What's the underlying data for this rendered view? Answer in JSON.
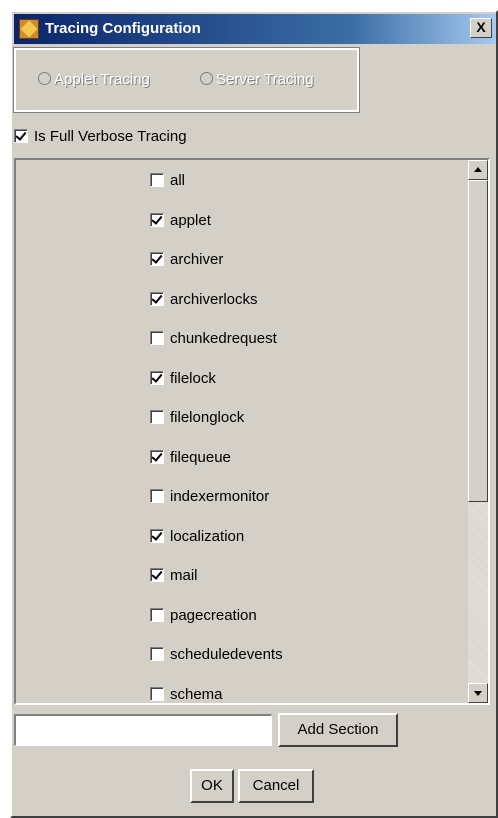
{
  "window": {
    "title": "Tracing Configuration",
    "close_label": "X"
  },
  "tracing_mode": {
    "options": [
      "Applet Tracing",
      "Server Tracing"
    ]
  },
  "verbose": {
    "label": "Is Full Verbose Tracing",
    "checked": true
  },
  "sections": [
    {
      "label": "all",
      "checked": false
    },
    {
      "label": "applet",
      "checked": true
    },
    {
      "label": "archiver",
      "checked": true
    },
    {
      "label": "archiverlocks",
      "checked": true
    },
    {
      "label": "chunkedrequest",
      "checked": false
    },
    {
      "label": "filelock",
      "checked": true
    },
    {
      "label": "filelonglock",
      "checked": false
    },
    {
      "label": "filequeue",
      "checked": true
    },
    {
      "label": "indexermonitor",
      "checked": false
    },
    {
      "label": "localization",
      "checked": true
    },
    {
      "label": "mail",
      "checked": true
    },
    {
      "label": "pagecreation",
      "checked": false
    },
    {
      "label": "scheduledevents",
      "checked": false
    },
    {
      "label": "schema",
      "checked": false
    }
  ],
  "add_section": {
    "value": "",
    "button_label": "Add Section"
  },
  "footer": {
    "ok_label": "OK",
    "cancel_label": "Cancel"
  }
}
